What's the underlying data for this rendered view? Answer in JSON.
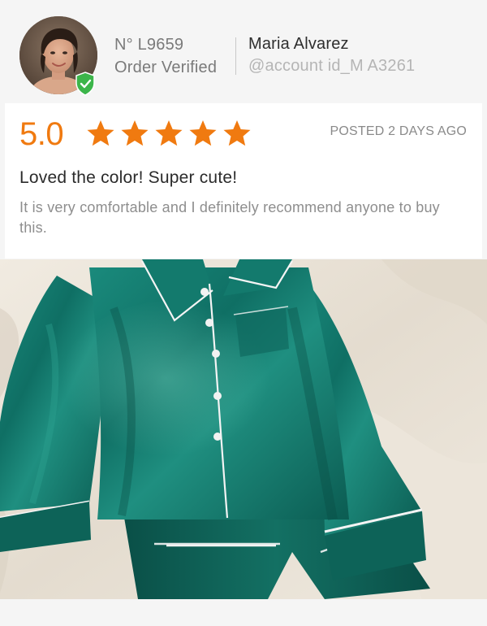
{
  "user": {
    "order_number": "N° L9659",
    "order_status": "Order Verified",
    "name": "Maria Alvarez",
    "handle": "@account id_M A3261",
    "badge_icon": "verified-shield-icon",
    "badge_color": "#3cb54a"
  },
  "review": {
    "rating": "5.0",
    "rating_value": 5,
    "rating_max": 5,
    "posted": "POSTED 2 DAYS AGO",
    "title": "Loved the color! Super cute!",
    "body": "It is very comfortable and I definitely recommend anyone to buy this.",
    "accent_color": "#f07a10"
  },
  "photo": {
    "fabric_color": "#12756a",
    "piping_color": "#f4f4f4"
  }
}
